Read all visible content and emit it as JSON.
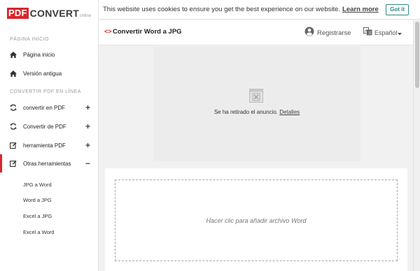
{
  "logo": {
    "pdf": "PDF",
    "convert": "CONVERT",
    "online": "online"
  },
  "sidebar": {
    "section_home": "PÁGINA INICIO",
    "home_items": [
      {
        "label": "Página inicio",
        "icon": "home-icon"
      },
      {
        "label": "Versión antigua",
        "icon": "home-icon"
      }
    ],
    "section_convert": "CONVERTIR PDF EN LÍNEA",
    "convert_items": [
      {
        "label": "convertir en PDF",
        "icon": "refresh-icon",
        "sign": "+"
      },
      {
        "label": "Convertir de PDF",
        "icon": "refresh-icon",
        "sign": "+"
      },
      {
        "label": "herramienta PDF",
        "icon": "edit-icon",
        "sign": "+"
      },
      {
        "label": "Otras herramientas",
        "icon": "edit-icon",
        "sign": "−"
      }
    ],
    "sub_items": [
      "JPG a Word",
      "Word a JPG",
      "Excel a JPG",
      "Excel a Word"
    ]
  },
  "cookie": {
    "text": "This website uses cookies to ensure you get the best experience on our website.",
    "link": "Learn more",
    "button": "Got it"
  },
  "header": {
    "code_icon": "<>",
    "title": "Convertir Word a JPG",
    "register": "Registrarse",
    "language": "Español"
  },
  "ad": {
    "text": "Se ha retirado el anuncio.",
    "link": "Detalles"
  },
  "upload": {
    "text": "Hacer clic para añadir archivo Word"
  },
  "colors": {
    "accent": "#d9262b",
    "teal": "#2a8a83"
  }
}
